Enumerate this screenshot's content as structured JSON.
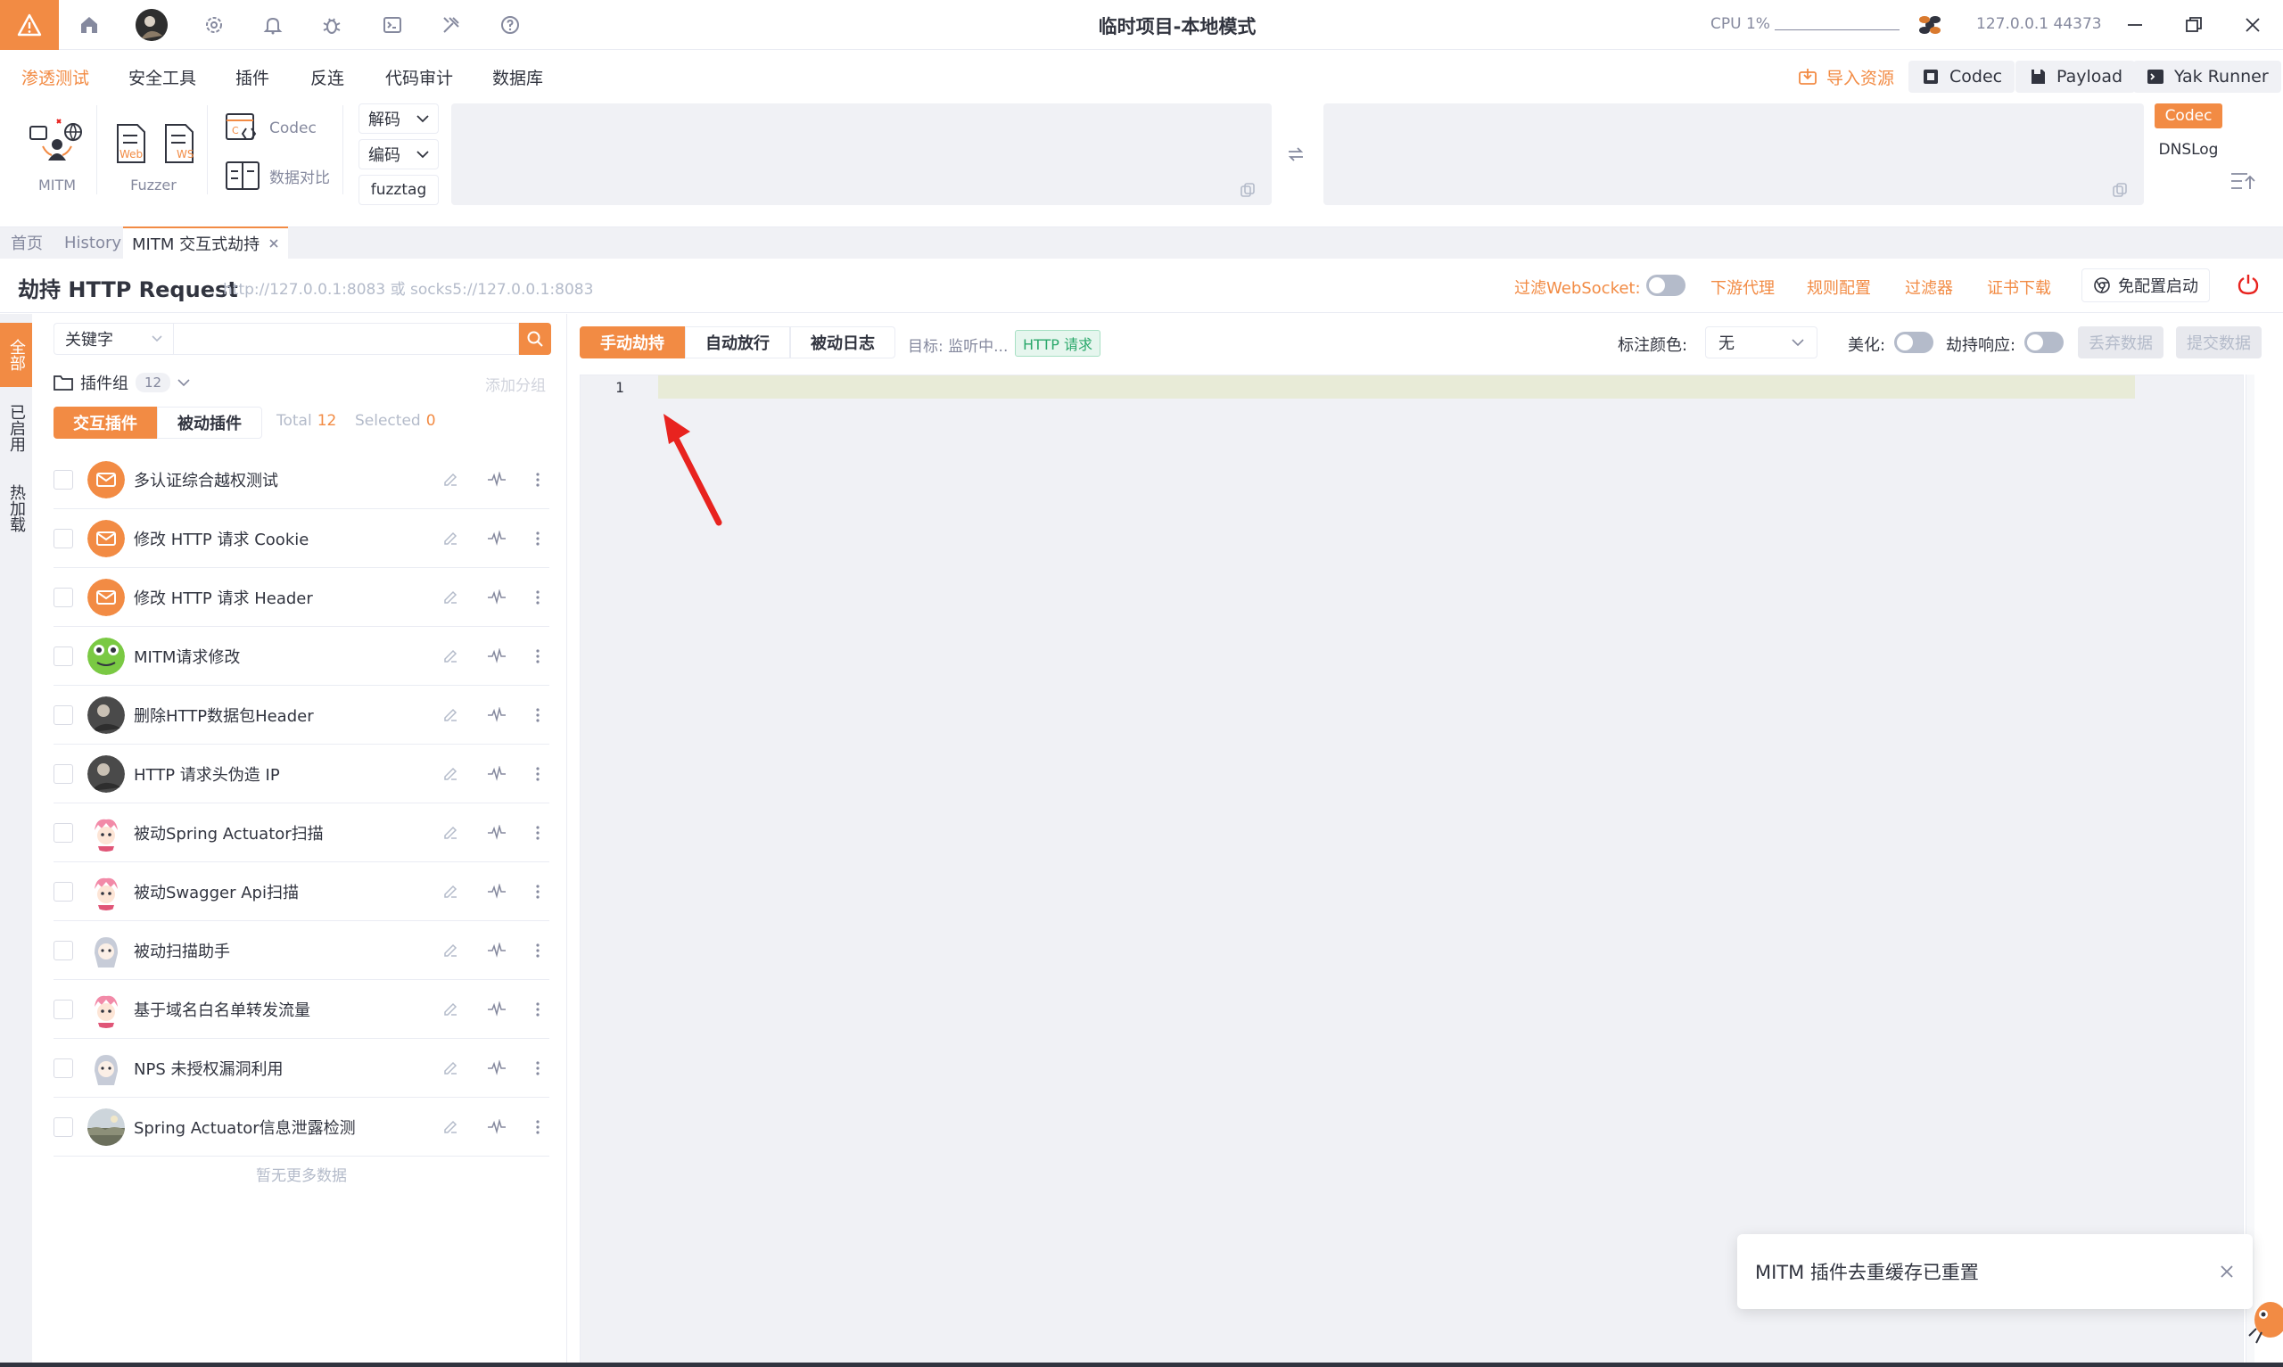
{
  "titlebar": {
    "title": "临时项目-本地模式",
    "cpu_label": "CPU 1%",
    "engine_addr": "127.0.0.1 44373"
  },
  "menu": {
    "items": [
      "渗透测试",
      "安全工具",
      "插件",
      "反连",
      "代码审计",
      "数据库"
    ],
    "right_buttons": {
      "import": "导入资源",
      "codec": "Codec",
      "payload": "Payload",
      "yak_runner": "Yak Runner"
    }
  },
  "toolbar": {
    "mitm_label": "MITM",
    "fuzzer_label": "Fuzzer",
    "web_tag": "Web",
    "ws_tag": "WS",
    "codec_label": "Codec",
    "compare_label": "数据对比",
    "decode_label": "解码",
    "encode_label": "编码",
    "fuzztag_label": "fuzztag",
    "codec_tag": "Codec",
    "dnslog_tag": "DNSLog"
  },
  "tabs": [
    "首页",
    "History",
    "MITM 交互式劫持"
  ],
  "header": {
    "title": "劫持 HTTP Request",
    "proxy_addr": "http://127.0.0.1:8083 或 socks5://127.0.0.1:8083",
    "filter_ws": "过滤WebSocket:",
    "downstream_proxy": "下游代理",
    "rule_config": "规则配置",
    "filter": "过滤器",
    "cert_download": "证书下载",
    "no_config_start": "免配置启动"
  },
  "vtabs": [
    "全部",
    "已启用",
    "热加载"
  ],
  "plugins": {
    "keyword_select": "关键字",
    "group_label": "插件组",
    "group_count": "12",
    "add_group": "添加分组",
    "tab_interactive": "交互插件",
    "tab_passive": "被动插件",
    "total_label": "Total",
    "total_value": "12",
    "selected_label": "Selected",
    "selected_value": "0",
    "no_more": "暂无更多数据",
    "items": [
      {
        "name": "多认证综合越权测试",
        "avatar": "orange-mail"
      },
      {
        "name": "修改 HTTP 请求 Cookie",
        "avatar": "orange-mail"
      },
      {
        "name": "修改 HTTP 请求 Header",
        "avatar": "orange-mail"
      },
      {
        "name": "MITM请求修改",
        "avatar": "green-frog"
      },
      {
        "name": "删除HTTP数据包Header",
        "avatar": "dark-photo"
      },
      {
        "name": "HTTP 请求头伪造 IP",
        "avatar": "dark-photo"
      },
      {
        "name": "被动Spring Actuator扫描",
        "avatar": "pink-anime"
      },
      {
        "name": "被动Swagger Api扫描",
        "avatar": "pink-anime"
      },
      {
        "name": "被动扫描助手",
        "avatar": "gray-anime"
      },
      {
        "name": "基于域名白名单转发流量",
        "avatar": "pink-anime"
      },
      {
        "name": "NPS 未授权漏洞利用",
        "avatar": "gray-anime"
      },
      {
        "name": "Spring Actuator信息泄露检测",
        "avatar": "landscape-photo"
      }
    ]
  },
  "main": {
    "manual_hijack": "手动劫持",
    "auto_release": "自动放行",
    "passive_log": "被动日志",
    "target_label": "目标: 监听中...",
    "http_request_tag": "HTTP 请求",
    "mark_color_label": "标注颜色:",
    "mark_color_value": "无",
    "beautify_label": "美化:",
    "hijack_response_label": "劫持响应:",
    "discard_data": "丢弃数据",
    "submit_data": "提交数据",
    "line_number": "1"
  },
  "notification": {
    "text": "MITM 插件去重缓存已重置"
  },
  "colors": {
    "accent": "#f28b44",
    "text": "#31343f",
    "muted": "#85899e",
    "panel": "#f0f1f5",
    "arrow": "#e8231f"
  }
}
